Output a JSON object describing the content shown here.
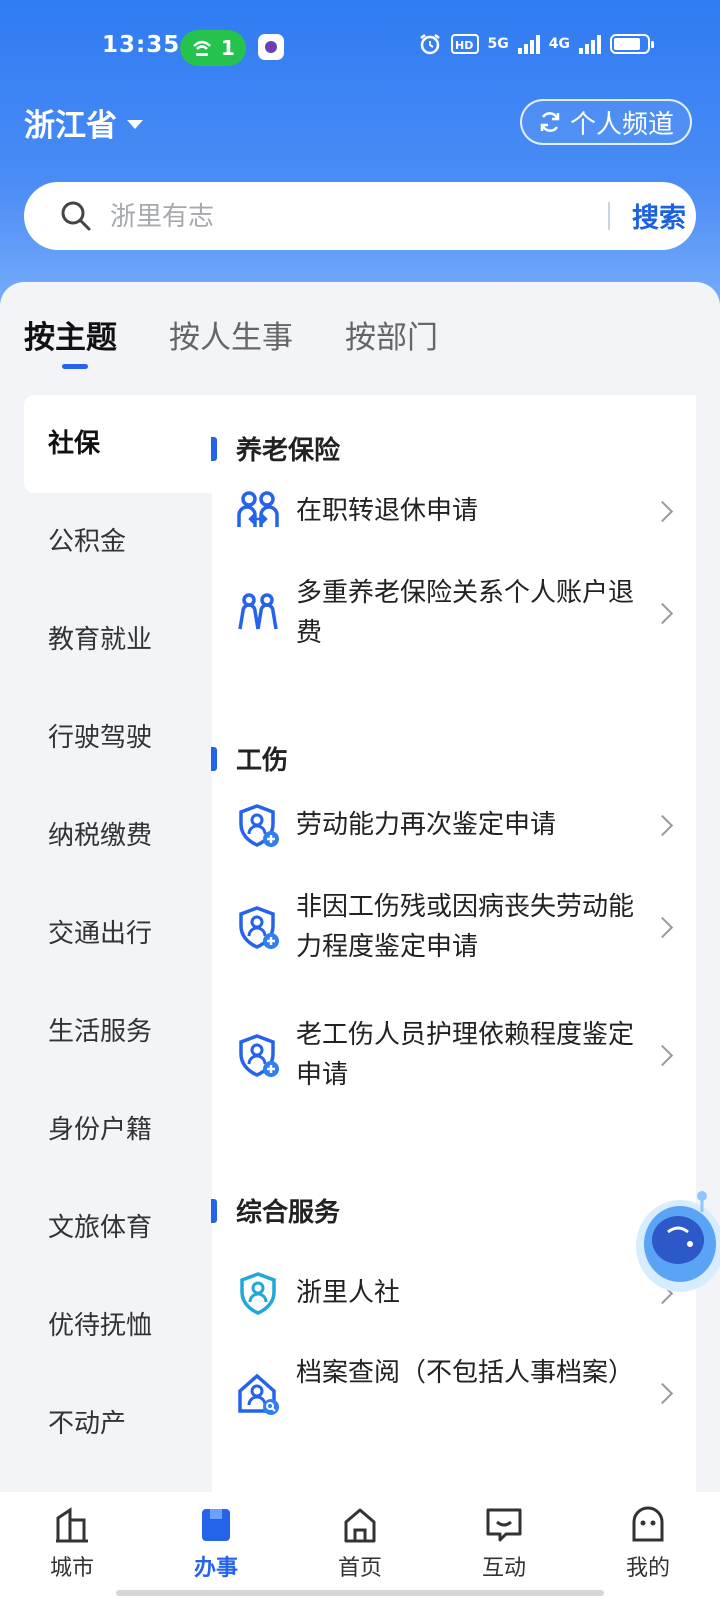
{
  "status_bar": {
    "time": "13:35",
    "hotspot_count": "1",
    "net1": "5G",
    "net2": "4G"
  },
  "header": {
    "province": "浙江省",
    "channel_button": "个人频道"
  },
  "search": {
    "placeholder": "浙里有志",
    "button": "搜索"
  },
  "tabs": [
    {
      "label": "按主题",
      "active": true
    },
    {
      "label": "按人生事",
      "active": false
    },
    {
      "label": "按部门",
      "active": false
    }
  ],
  "categories": [
    {
      "label": "社保",
      "active": true
    },
    {
      "label": "公积金"
    },
    {
      "label": "教育就业"
    },
    {
      "label": "行驶驾驶"
    },
    {
      "label": "纳税缴费"
    },
    {
      "label": "交通出行"
    },
    {
      "label": "生活服务"
    },
    {
      "label": "身份户籍"
    },
    {
      "label": "文旅体育"
    },
    {
      "label": "优待抚恤"
    },
    {
      "label": "不动产"
    }
  ],
  "sections": [
    {
      "title": "养老保险",
      "items": [
        {
          "label": "在职转退休申请",
          "icon": "people-transfer-icon"
        },
        {
          "label": "多重养老保险关系个人账户退费",
          "icon": "people-icon"
        }
      ]
    },
    {
      "title": "工伤",
      "items": [
        {
          "label": "劳动能力再次鉴定申请",
          "icon": "shield-user-add-icon"
        },
        {
          "label": "非因工伤残或因病丧失劳动能力程度鉴定申请",
          "icon": "shield-user-add-icon"
        },
        {
          "label": "老工伤人员护理依赖程度鉴定申请",
          "icon": "shield-user-add-icon"
        }
      ]
    },
    {
      "title": "综合服务",
      "items": [
        {
          "label": "浙里人社",
          "icon": "shield-user-icon"
        },
        {
          "label": "档案查阅（不包括人事档案）",
          "icon": "house-user-search-icon"
        }
      ]
    }
  ],
  "bottom_nav": [
    {
      "label": "城市",
      "icon": "city-icon"
    },
    {
      "label": "办事",
      "icon": "bookmark-icon",
      "active": true
    },
    {
      "label": "首页",
      "icon": "home-icon"
    },
    {
      "label": "互动",
      "icon": "chat-icon"
    },
    {
      "label": "我的",
      "icon": "profile-icon"
    }
  ],
  "colors": {
    "accent": "#2563eb",
    "hero_top": "#2f7bf2",
    "hotspot": "#26c24e"
  }
}
